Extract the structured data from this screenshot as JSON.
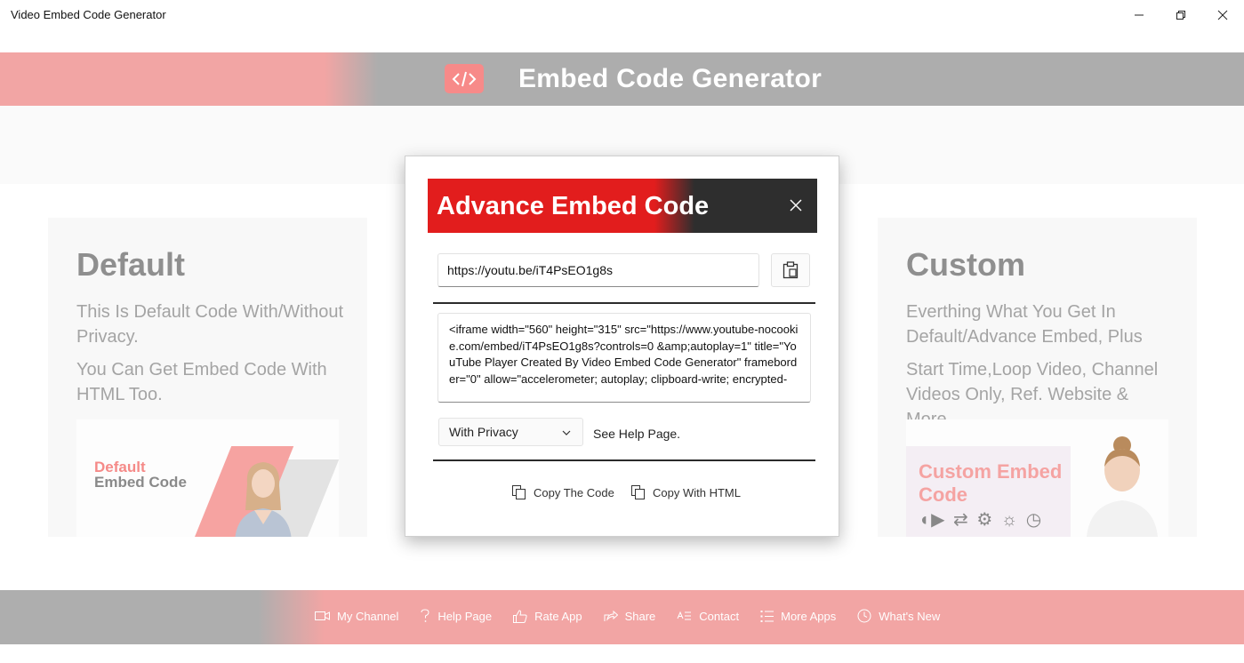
{
  "window": {
    "title": "Video Embed Code Generator"
  },
  "header": {
    "title": "Embed Code Generator",
    "logo_glyph": "</>"
  },
  "cards": {
    "default": {
      "title": "Default",
      "desc1": "This Is Default Code With/Without Privacy.",
      "desc2": "You Can Get Embed Code With HTML Too.",
      "thumb_line1": "Default",
      "thumb_line2": "Embed Code"
    },
    "custom": {
      "title": "Custom",
      "desc1": "Everthing What You Get In Default/Advance Embed, Plus",
      "desc2": "Start Time,Loop Video, Channel Videos Only, Ref. Website & More.",
      "thumb_line1": "Custom Embed Code"
    }
  },
  "modal": {
    "title": "Advance Embed Code",
    "url_value": "https://youtu.be/iT4PsEO1g8s",
    "code": "<iframe width=\"560\" height=\"315\" src=\"https://www.youtube-nocookie.com/embed/iT4PsEO1g8s?controls=0 &amp;autoplay=1\" title=\"YouTube Player Created By Video Embed Code Generator\" frameborder=\"0\" allow=\"accelerometer; autoplay; clipboard-write; encrypted-",
    "privacy_selected": "With Privacy",
    "help_text": "See Help Page.",
    "copy_code_label": "Copy The Code",
    "copy_html_label": "Copy With HTML"
  },
  "footer": {
    "items": [
      {
        "label": "My Channel",
        "icon": "video-camera-icon"
      },
      {
        "label": "Help Page",
        "icon": "question-icon"
      },
      {
        "label": "Rate App",
        "icon": "thumbs-up-icon"
      },
      {
        "label": "Share",
        "icon": "share-icon"
      },
      {
        "label": "Contact",
        "icon": "contact-card-icon"
      },
      {
        "label": "More Apps",
        "icon": "list-icon"
      },
      {
        "label": "What's New",
        "icon": "clock-icon"
      }
    ]
  },
  "colors": {
    "brand_pink": "#f2a5a4",
    "brand_gray": "#adadad",
    "modal_red": "#e21d1d",
    "modal_dark": "#2e2e2e"
  }
}
